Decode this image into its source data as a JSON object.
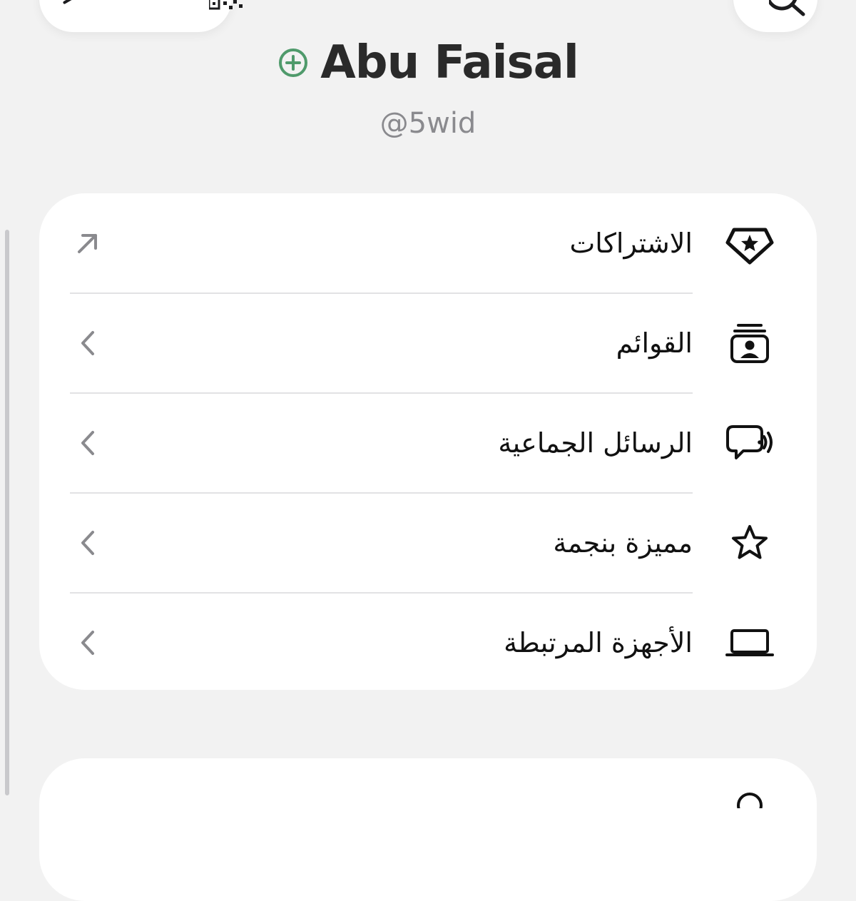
{
  "profile": {
    "name": "Abu Faisal",
    "handle": "@5wid"
  },
  "colors": {
    "accent_green": "#4f9a6b",
    "background": "#f2f2f2",
    "card": "#ffffff",
    "text_primary": "#111111",
    "text_secondary": "#8a8a8e"
  },
  "menu": {
    "items": [
      {
        "label": "الاشتراكات",
        "icon": "badge-star-icon",
        "accessory": "external-link-icon"
      },
      {
        "label": "القوائم",
        "icon": "contact-list-icon",
        "accessory": "chevron-left-icon"
      },
      {
        "label": "الرسائل الجماعية",
        "icon": "broadcast-bubble-icon",
        "accessory": "chevron-left-icon"
      },
      {
        "label": "مميزة بنجمة",
        "icon": "star-icon",
        "accessory": "chevron-left-icon"
      },
      {
        "label": "الأجهزة المرتبطة",
        "icon": "laptop-icon",
        "accessory": "chevron-left-icon"
      }
    ]
  }
}
